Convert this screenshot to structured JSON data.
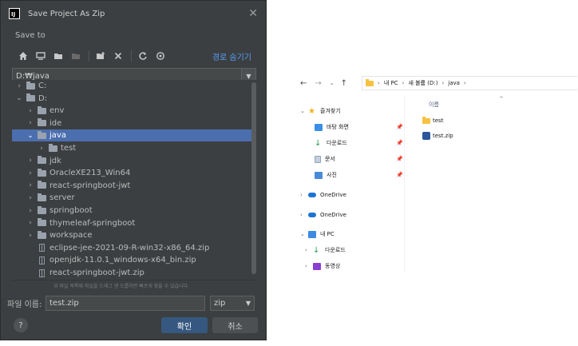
{
  "dialog": {
    "title": "Save Project As Zip",
    "close": "✕",
    "save_to": "Save to",
    "hide_path": "경로 숨기기",
    "path": "D:₩java",
    "tree": [
      {
        "level": 0,
        "chev": "›",
        "label": "C:",
        "icon": "folder",
        "selected": false
      },
      {
        "level": 0,
        "chev": "⌄",
        "label": "D:",
        "icon": "folder",
        "selected": false
      },
      {
        "level": 1,
        "chev": "›",
        "label": "env",
        "icon": "folder",
        "selected": false
      },
      {
        "level": 1,
        "chev": "›",
        "label": "ide",
        "icon": "folder",
        "selected": false
      },
      {
        "level": 1,
        "chev": "⌄",
        "label": "java",
        "icon": "folder",
        "selected": true
      },
      {
        "level": 2,
        "chev": "›",
        "label": "test",
        "icon": "folder",
        "selected": false
      },
      {
        "level": 1,
        "chev": "›",
        "label": "jdk",
        "icon": "folder",
        "selected": false
      },
      {
        "level": 1,
        "chev": "›",
        "label": "OracleXE213_Win64",
        "icon": "folder",
        "selected": false
      },
      {
        "level": 1,
        "chev": "›",
        "label": "react-springboot-jwt",
        "icon": "folder",
        "selected": false
      },
      {
        "level": 1,
        "chev": "›",
        "label": "server",
        "icon": "folder",
        "selected": false
      },
      {
        "level": 1,
        "chev": "›",
        "label": "springboot",
        "icon": "folder",
        "selected": false
      },
      {
        "level": 1,
        "chev": "›",
        "label": "thymeleaf-springboot",
        "icon": "folder",
        "selected": false
      },
      {
        "level": 1,
        "chev": "›",
        "label": "workspace",
        "icon": "folder",
        "selected": false
      },
      {
        "level": 1,
        "chev": "",
        "label": "eclipse-jee-2021-09-R-win32-x86_64.zip",
        "icon": "zip",
        "selected": false
      },
      {
        "level": 1,
        "chev": "",
        "label": "openjdk-11.0.1_windows-x64_bin.zip",
        "icon": "zip",
        "selected": false
      },
      {
        "level": 1,
        "chev": "",
        "label": "react-springboot-jwt.zip",
        "icon": "zip",
        "selected": false
      }
    ],
    "hint": "위 파일 목록에 파일을 드래그 앤 드롭하면 빠르게 찾을 수 있습니다",
    "filename_label": "파일 이름:",
    "filename_value": "test.zip",
    "extension": "zip",
    "help": "?",
    "ok": "확인",
    "cancel": "취소"
  },
  "explorer": {
    "breadcrumb": [
      "내 PC",
      "새 볼륨 (D:)",
      "java"
    ],
    "column_name": "이름",
    "quick_access": "즐겨찾기",
    "nav_items": [
      {
        "label": "바탕 화면",
        "icon": "desk",
        "pinned": true
      },
      {
        "label": "다운로드",
        "icon": "down",
        "pinned": true
      },
      {
        "label": "문서",
        "icon": "doc",
        "pinned": true
      },
      {
        "label": "사진",
        "icon": "pic",
        "pinned": true
      }
    ],
    "onedrive1": "OneDrive",
    "onedrive2": "OneDrive",
    "this_pc": "내 PC",
    "pc_items": [
      {
        "label": "다운로드",
        "icon": "down"
      },
      {
        "label": "동영상",
        "icon": "video"
      }
    ],
    "files": [
      {
        "name": "test",
        "type": "folder"
      },
      {
        "name": "test.zip",
        "type": "zip"
      }
    ]
  }
}
